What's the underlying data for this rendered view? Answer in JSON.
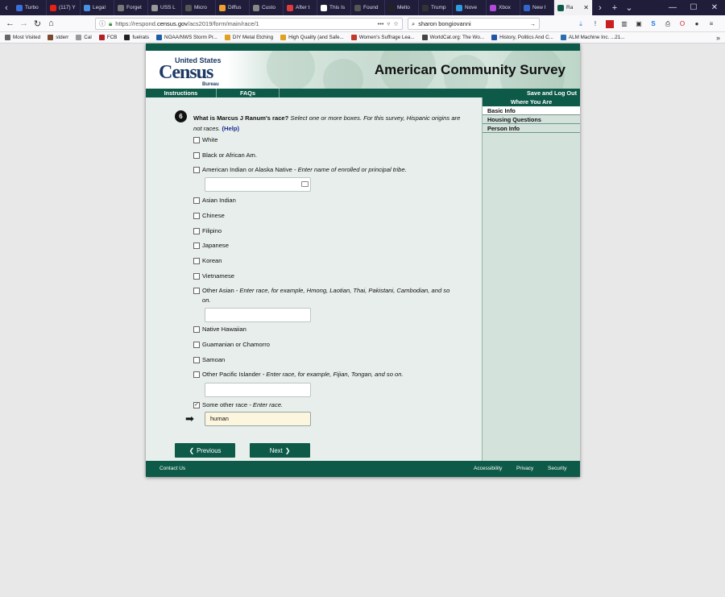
{
  "browser": {
    "tabs": [
      {
        "label": "Turbo",
        "color": "#3a6fd8"
      },
      {
        "label": "(117) Y",
        "color": "#e62117"
      },
      {
        "label": "Legal",
        "color": "#4a90e2"
      },
      {
        "label": "Forget",
        "color": "#777777"
      },
      {
        "label": "USS L",
        "color": "#999999"
      },
      {
        "label": "Micro",
        "color": "#555555"
      },
      {
        "label": "Diffus",
        "color": "#f0a030"
      },
      {
        "label": "Custo",
        "color": "#888888"
      },
      {
        "label": "After t",
        "color": "#e03b3b"
      },
      {
        "label": "This Is",
        "color": "#ffffff"
      },
      {
        "label": "Found",
        "color": "#555555"
      },
      {
        "label": "Melto",
        "color": "#222222"
      },
      {
        "label": "Trump",
        "color": "#333333"
      },
      {
        "label": "Nove",
        "color": "#2f9be0"
      },
      {
        "label": "Xbox",
        "color": "#b04ad8"
      },
      {
        "label": "New I",
        "color": "#3366cc"
      }
    ],
    "active_tab": {
      "label": "Ra",
      "color": "#0e5a48"
    },
    "url_prefix": "https://respond.",
    "url_domain": "census.gov",
    "url_suffix": "/acs2019/form/main/race/1",
    "url_more": "•••",
    "search_value": "sharon bongiovanni",
    "bookmarks": [
      {
        "label": "Most Visited",
        "color": "#666666"
      },
      {
        "label": "stderr",
        "color": "#7a4a2a"
      },
      {
        "label": "Cal",
        "color": "#999999"
      },
      {
        "label": "FCB",
        "color": "#b3202a"
      },
      {
        "label": "fuelrats",
        "color": "#222222"
      },
      {
        "label": "NOAA/NWS Storm Pr...",
        "color": "#1d5ea8"
      },
      {
        "label": "DIY Metal Etching",
        "color": "#e0a020"
      },
      {
        "label": "High Quality (and Safe...",
        "color": "#e0a020"
      },
      {
        "label": "Women's Suffrage Lea...",
        "color": "#c0392b"
      },
      {
        "label": "WorldCat.org: The Wo...",
        "color": "#444444"
      },
      {
        "label": "History, Politics And C...",
        "color": "#2255aa"
      },
      {
        "label": "ALM Machine Inc. ...21...",
        "color": "#2a6fb0"
      }
    ]
  },
  "header": {
    "logo_line1": "United States",
    "logo_line2": "Census",
    "logo_line3": "Bureau",
    "title": "American Community Survey"
  },
  "menu": {
    "instructions": "Instructions",
    "faqs": "FAQs",
    "save_logout": "Save and Log Out"
  },
  "sidebar": {
    "heading": "Where You Are",
    "items": [
      "Basic Info",
      "Housing Questions",
      "Person Info"
    ]
  },
  "question": {
    "number": "6",
    "text_bold": "What is Marcus J Ranum's race?",
    "text_italic": " Select one or more boxes. For this survey, Hispanic origins are not races.",
    "help": "(Help)"
  },
  "options": [
    {
      "label": "White",
      "checked": false
    },
    {
      "label": "Black or African Am.",
      "checked": false
    },
    {
      "label": "American Indian or Alaska Native",
      "hint": " - Enter name of enrolled or principal tribe.",
      "checked": false
    },
    {
      "label": "Asian Indian",
      "checked": false
    },
    {
      "label": "Chinese",
      "checked": false
    },
    {
      "label": "Filipino",
      "checked": false
    },
    {
      "label": "Japanese",
      "checked": false
    },
    {
      "label": "Korean",
      "checked": false
    },
    {
      "label": "Vietnamese",
      "checked": false
    },
    {
      "label": "Other Asian",
      "hint": " - Enter race, for example, Hmong, Laotian, Thai, Pakistani, Cambodian, and so on.",
      "checked": false
    },
    {
      "label": "Native Hawaiian",
      "checked": false
    },
    {
      "label": "Guamanian or Chamorro",
      "checked": false
    },
    {
      "label": "Samoan",
      "checked": false
    },
    {
      "label": "Other Pacific Islander",
      "hint": " - Enter race, for example, Fijian, Tongan, and so on.",
      "checked": false
    },
    {
      "label": "Some other race",
      "hint": " - Enter race.",
      "checked": true
    }
  ],
  "inputs": {
    "tribe_value": "",
    "other_asian_value": "",
    "other_pacific_value": "",
    "some_other_race_value": "human"
  },
  "buttons": {
    "previous": "Previous",
    "next": "Next"
  },
  "footer": {
    "contact": "Contact Us",
    "accessibility": "Accessibility",
    "privacy": "Privacy",
    "security": "Security"
  },
  "colors": {
    "census_green": "#0e5a48",
    "input_highlight": "#fdf6df"
  }
}
